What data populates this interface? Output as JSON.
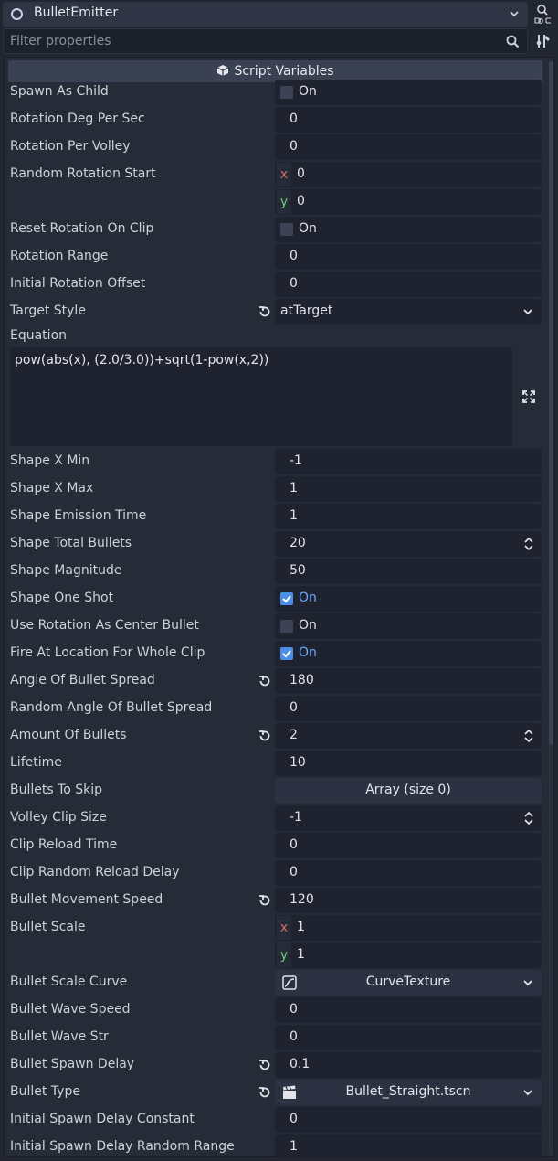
{
  "node": {
    "name": "BulletEmitter"
  },
  "filter": {
    "placeholder": "Filter properties"
  },
  "section": {
    "title": "Script Variables"
  },
  "properties": {
    "spawn_as_child": {
      "label": "Spawn As Child",
      "value": "On",
      "checked": false
    },
    "rotation_deg_per_sec": {
      "label": "Rotation Deg Per Sec",
      "value": "0"
    },
    "rotation_per_volley": {
      "label": "Rotation Per Volley",
      "value": "0"
    },
    "random_rotation_start": {
      "label": "Random Rotation Start",
      "x_axis": "x",
      "y_axis": "y",
      "x": "0",
      "y": "0"
    },
    "reset_rotation_on_clip": {
      "label": "Reset Rotation On Clip",
      "value": "On",
      "checked": false
    },
    "rotation_range": {
      "label": "Rotation Range",
      "value": "0"
    },
    "initial_rotation_offset": {
      "label": "Initial Rotation Offset",
      "value": "0"
    },
    "target_style": {
      "label": "Target Style",
      "value": "atTarget"
    },
    "equation": {
      "label": "Equation",
      "value": "pow(abs(x), (2.0/3.0))+sqrt(1-pow(x,2))"
    },
    "shape_x_min": {
      "label": "Shape X Min",
      "value": "-1"
    },
    "shape_x_max": {
      "label": "Shape X Max",
      "value": "1"
    },
    "shape_emission_time": {
      "label": "Shape Emission Time",
      "value": "1"
    },
    "shape_total_bullets": {
      "label": "Shape Total Bullets",
      "value": "20"
    },
    "shape_magnitude": {
      "label": "Shape Magnitude",
      "value": "50"
    },
    "shape_one_shot": {
      "label": "Shape One Shot",
      "value": "On",
      "checked": true
    },
    "use_rotation_as_center_bullet": {
      "label": "Use Rotation As Center Bullet",
      "value": "On",
      "checked": false
    },
    "fire_at_location_for_whole_clip": {
      "label": "Fire At Location For Whole Clip",
      "value": "On",
      "checked": true
    },
    "angle_of_bullet_spread": {
      "label": "Angle Of Bullet Spread",
      "value": "180"
    },
    "random_angle_of_bullet_spread": {
      "label": "Random Angle Of Bullet Spread",
      "value": "0"
    },
    "amount_of_bullets": {
      "label": "Amount Of Bullets",
      "value": "2"
    },
    "lifetime": {
      "label": "Lifetime",
      "value": "10"
    },
    "bullets_to_skip": {
      "label": "Bullets To Skip",
      "value": "Array (size 0)"
    },
    "volley_clip_size": {
      "label": "Volley Clip Size",
      "value": "-1"
    },
    "clip_reload_time": {
      "label": "Clip Reload Time",
      "value": "0"
    },
    "clip_random_reload_delay": {
      "label": "Clip Random Reload Delay",
      "value": "0"
    },
    "bullet_movement_speed": {
      "label": "Bullet Movement Speed",
      "value": "120"
    },
    "bullet_scale": {
      "label": "Bullet Scale",
      "x_axis": "x",
      "y_axis": "y",
      "x": "1",
      "y": "1"
    },
    "bullet_scale_curve": {
      "label": "Bullet Scale Curve",
      "value": "CurveTexture"
    },
    "bullet_wave_speed": {
      "label": "Bullet Wave Speed",
      "value": "0"
    },
    "bullet_wave_str": {
      "label": "Bullet Wave Str",
      "value": "0"
    },
    "bullet_spawn_delay": {
      "label": "Bullet Spawn Delay",
      "value": "0.1"
    },
    "bullet_type": {
      "label": "Bullet Type",
      "value": "Bullet_Straight.tscn"
    },
    "initial_spawn_delay_constant": {
      "label": "Initial Spawn Delay Constant",
      "value": "0"
    },
    "initial_spawn_delay_random_range": {
      "label": "Initial Spawn Delay Random Range",
      "value": "1"
    }
  },
  "icons": {
    "node": "node-circle-icon",
    "doc": "doc-icon",
    "search": "search-icon",
    "tools": "tools-icon",
    "section": "cube-icon",
    "revert": "revert-icon",
    "expand": "expand-icon",
    "curve": "curve-texture-icon",
    "scene": "packed-scene-icon"
  },
  "colors": {
    "background": "#222631",
    "panel": "#262b38",
    "field": "#1f2330",
    "accent": "#4a8ee8",
    "checked_text": "#6fa8ff",
    "axis_x": "#d86b6b",
    "axis_y": "#6fc47a"
  }
}
